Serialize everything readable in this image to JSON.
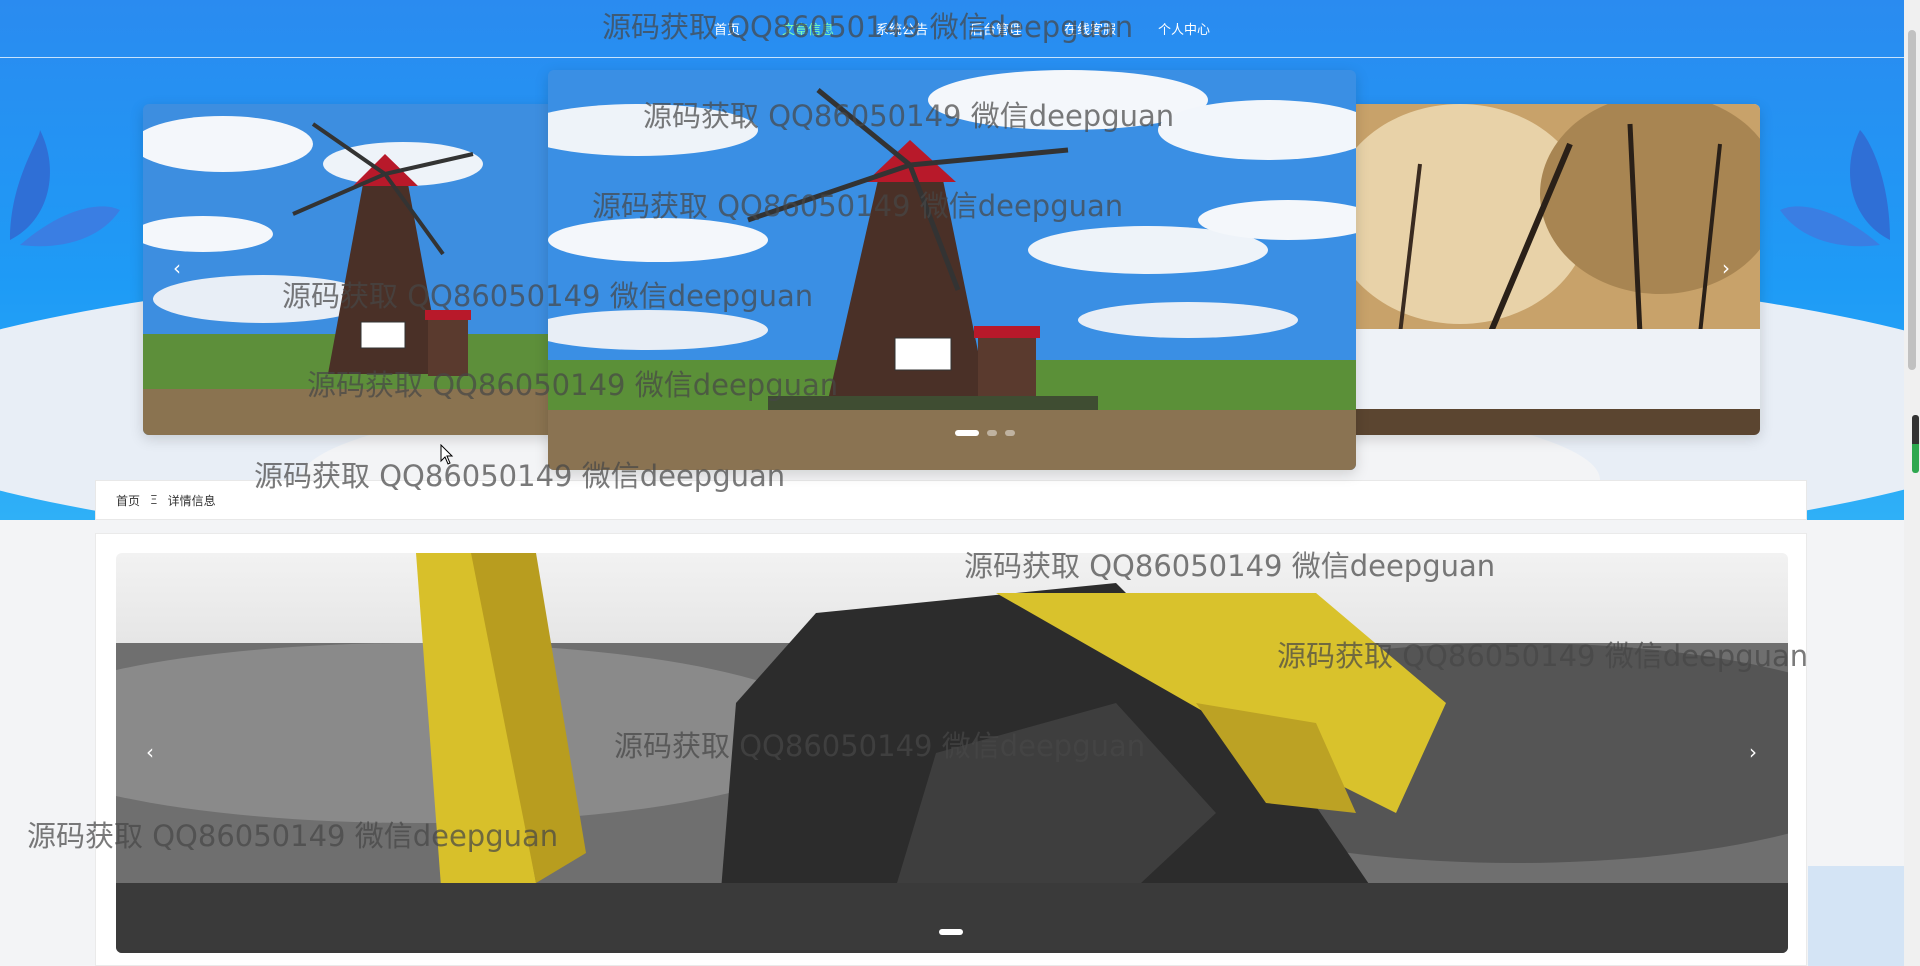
{
  "nav": {
    "items": [
      "首页",
      "文章信息",
      "系统公告",
      "后台管理",
      "在线客服",
      "个人中心"
    ],
    "active_index": 1
  },
  "carousel": {
    "prev_glyph": "‹",
    "next_glyph": "›",
    "active_dot": 0,
    "dot_count": 3,
    "slides": [
      "windmill-landscape",
      "windmill-landscape",
      "snowy-forest"
    ]
  },
  "breadcrumb": {
    "home": "首页",
    "separator": "Ξ",
    "current": "详情信息"
  },
  "detail": {
    "image": "excavator-in-coal-field",
    "prev_glyph": "‹",
    "next_glyph": "›"
  },
  "watermark": {
    "text": "源码获取 QQ86050149 微信deepguan"
  },
  "colors": {
    "header_blue": "#2a8bf0",
    "nav_active": "#7dffb0",
    "page_bg": "#f3f4f6"
  }
}
